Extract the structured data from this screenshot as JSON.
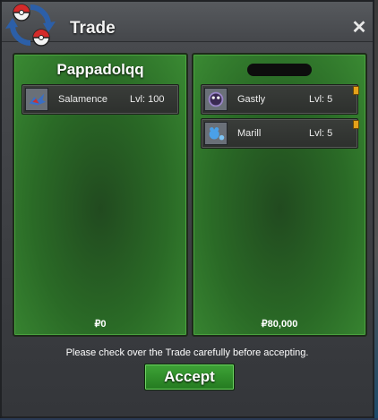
{
  "window": {
    "title": "Trade",
    "close_label": "✕",
    "logo_icon": "trade-swap-pokeball-icon"
  },
  "left_panel": {
    "trader_name": "Pappadolqq",
    "pokemon": [
      {
        "name": "Salamence",
        "level": "Lvl: 100",
        "icon": "salamence-icon"
      }
    ],
    "money": "₽0"
  },
  "right_panel": {
    "trader_name_hidden": true,
    "pokemon": [
      {
        "name": "Gastly",
        "level": "Lvl: 5",
        "icon": "gastly-icon",
        "flagged": true
      },
      {
        "name": "Marill",
        "level": "Lvl: 5",
        "icon": "marill-icon",
        "flagged": true
      }
    ],
    "money": "₽80,000"
  },
  "footer": {
    "notice": "Please check over the Trade carefully before accepting.",
    "accept_label": "Accept"
  },
  "colors": {
    "panel_green": "#2a6a26",
    "accept_green": "#3ea437",
    "flag_orange": "#e5a21a"
  }
}
